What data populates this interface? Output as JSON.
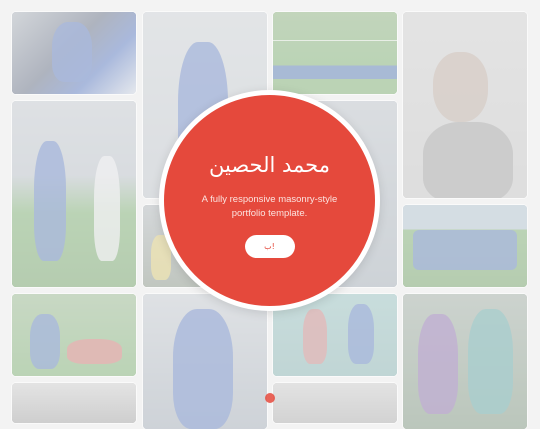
{
  "hero": {
    "title": "محمد الحصين",
    "subtitle": "A fully responsive masonry-style portfolio template.",
    "button_label": "ب!"
  },
  "gallery": {
    "item_count": 16
  },
  "colors": {
    "accent": "#e5493c",
    "background": "#f3f3f3",
    "overlay": "rgba(245,245,245,0.62)",
    "kit_blue": "#2f57b3",
    "pitch_green": "#5c9c4e",
    "stadium_teal": "#7fb5b3"
  }
}
